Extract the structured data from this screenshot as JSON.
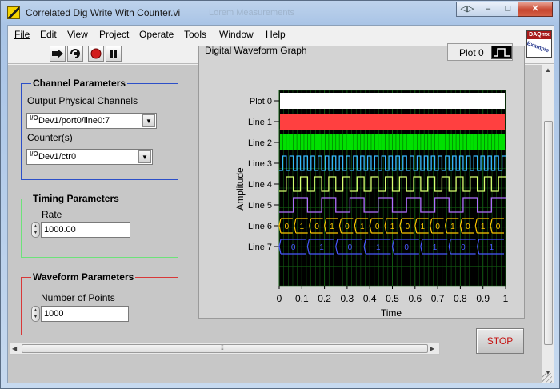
{
  "window": {
    "title": "Correlated Dig Write With Counter.vi",
    "title_ghost": "Lorem Measurements",
    "buttons": {
      "nav": "◁▷",
      "minimize": "–",
      "maximize": "□",
      "close": "✕"
    }
  },
  "menu": [
    "File",
    "Edit",
    "View",
    "Project",
    "Operate",
    "Tools",
    "Window",
    "Help"
  ],
  "toolbar": {
    "icons": [
      "run-icon",
      "run-continuously-icon",
      "abort-icon",
      "pause-icon"
    ],
    "help_label": "?",
    "badge_top": "DAQmx",
    "badge_bottom": "Example"
  },
  "channel": {
    "title": "Channel Parameters",
    "output_label": "Output Physical Channels",
    "output_value": "Dev1/port0/line0:7",
    "counter_label": "Counter(s)",
    "counter_value": "Dev1/ctr0",
    "io_tag": "I/O"
  },
  "timing": {
    "title": "Timing Parameters",
    "rate_label": "Rate",
    "rate_value": "1000.00"
  },
  "waveform": {
    "title": "Waveform Parameters",
    "points_label": "Number of Points",
    "points_value": "1000"
  },
  "graph": {
    "title": "Digital Waveform Graph",
    "legend_label": "Plot 0",
    "y_label": "Amplitude",
    "x_label": "Time",
    "rows": [
      "Plot 0",
      "Line 1",
      "Line 2",
      "Line 3",
      "Line 4",
      "Line 5",
      "Line 6",
      "Line 7"
    ],
    "x_ticks": [
      "0",
      "0.1",
      "0.2",
      "0.3",
      "0.4",
      "0.5",
      "0.6",
      "0.7",
      "0.8",
      "0.9",
      "1"
    ],
    "line6_values": [
      "0",
      "1",
      "0",
      "1",
      "0",
      "1",
      "0",
      "1",
      "0",
      "1",
      "0",
      "1",
      "0",
      "1",
      "0"
    ],
    "line7_values": [
      "0",
      "1",
      "0",
      "1",
      "0",
      "1",
      "0",
      "1"
    ],
    "colors": {
      "plot0": "#ffffff",
      "line1": "#ff4040",
      "line2": "#00e000",
      "line3": "#38b8ff",
      "line4": "#d8ff70",
      "line5": "#b070ff",
      "line6": "#ffc800",
      "line7": "#4858ff",
      "grid": "#125a12",
      "background": "#000000"
    }
  },
  "stop_label": "STOP"
}
